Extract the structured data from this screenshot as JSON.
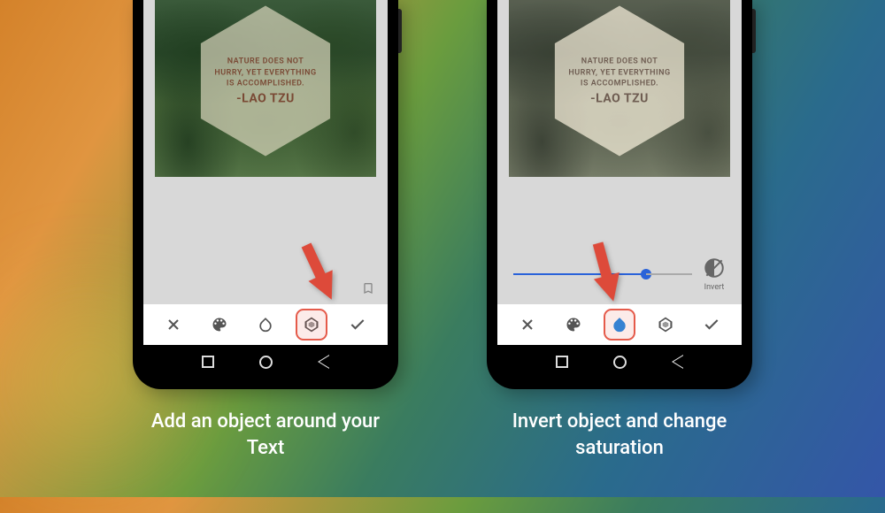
{
  "quote": {
    "line1": "NATURE DOES NOT",
    "line2": "HURRY, YET EVERYTHING",
    "line3": "IS ACCOMPLISHED.",
    "author": "-LAO TZU"
  },
  "toolbar": {
    "close": "✕",
    "palette": "palette",
    "saturation": "saturation",
    "shape": "shape",
    "confirm": "✓"
  },
  "slider": {
    "invert_label": "Invert"
  },
  "captions": {
    "left": "Add an object around your Text",
    "right": "Invert object and change saturation"
  }
}
